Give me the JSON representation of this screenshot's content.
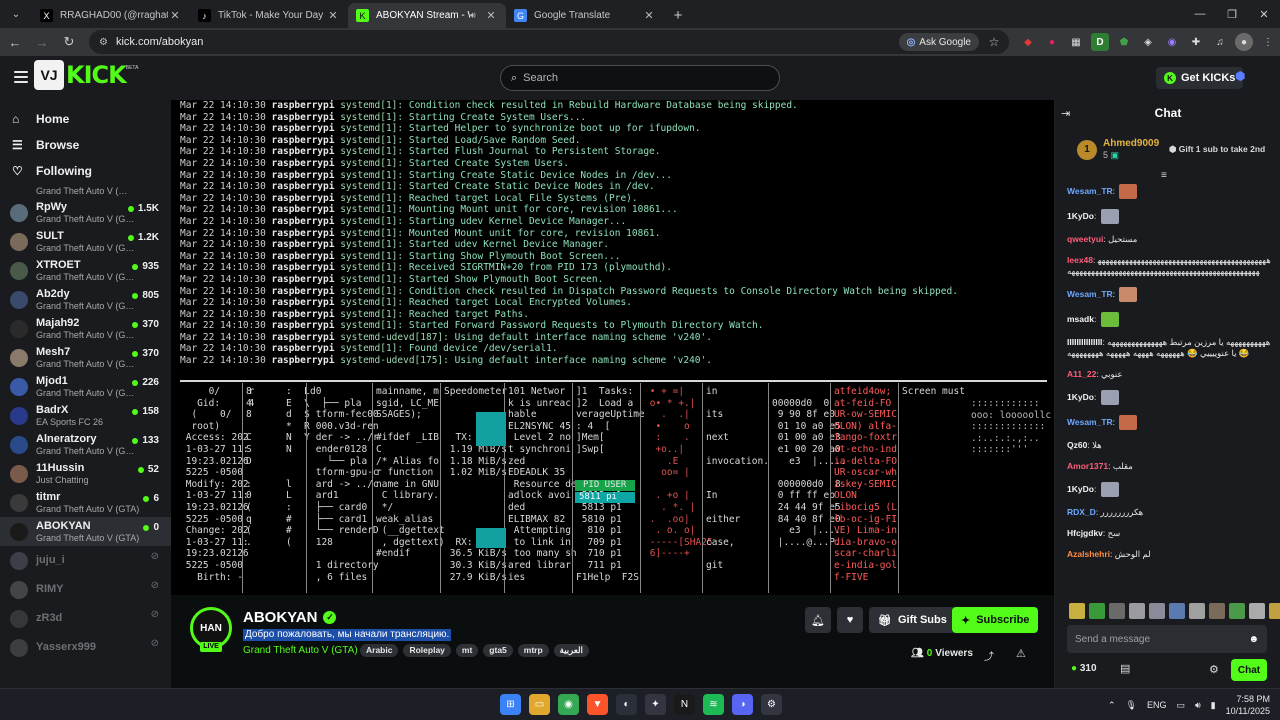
{
  "browser": {
    "tabs": [
      {
        "title": "RRAGHAD00 (@rragha006) / X",
        "fav": "X",
        "favBg": "#000000",
        "favFg": "#ffffff",
        "active": false
      },
      {
        "title": "TikTok - Make Your Day",
        "fav": "♪",
        "favBg": "#000000",
        "favFg": "#ffffff",
        "active": false
      },
      {
        "title": "ABOKYAN Stream - Watch Li",
        "fav": "K",
        "favBg": "#53fc18",
        "favFg": "#000000",
        "active": true
      },
      {
        "title": "Google Translate",
        "fav": "G",
        "favBg": "#4285f4",
        "favFg": "#ffffff",
        "active": false
      }
    ],
    "url": "kick.com/abokyan",
    "ask_google": "Ask Google"
  },
  "kick": {
    "logo_text": "KICK",
    "logo_beta": "BETA",
    "search_placeholder": "Search",
    "get_kicks": "Get KICKs"
  },
  "sidebar": {
    "nav": [
      {
        "label": "Home",
        "icon": "⌂"
      },
      {
        "label": "Browse",
        "icon": "☰"
      },
      {
        "label": "Following",
        "icon": "♡"
      }
    ],
    "partial_game": "Grand Theft Auto V (…",
    "channels": [
      {
        "name": "RpWy",
        "game": "Grand Theft Auto V (G…",
        "viewers": "1.5K",
        "live": true,
        "color": "#5a6b7a"
      },
      {
        "name": "SULT",
        "game": "Grand Theft Auto V (G…",
        "viewers": "1.2K",
        "live": true,
        "color": "#7a6a5a"
      },
      {
        "name": "XTROET",
        "game": "Grand Theft Auto V (G…",
        "viewers": "935",
        "live": true,
        "color": "#4a5a4a"
      },
      {
        "name": "Ab2dy",
        "game": "Grand Theft Auto V (G…",
        "viewers": "805",
        "live": true,
        "color": "#3a4a6a"
      },
      {
        "name": "Majah92",
        "game": "Grand Theft Auto V (G…",
        "viewers": "370",
        "live": true,
        "color": "#2a2a2a"
      },
      {
        "name": "Mesh7",
        "game": "Grand Theft Auto V (G…",
        "viewers": "370",
        "live": true,
        "color": "#8a7a6a"
      },
      {
        "name": "Mjod1",
        "game": "Grand Theft Auto V (G…",
        "viewers": "226",
        "live": true,
        "color": "#3a5aa8"
      },
      {
        "name": "BadrX",
        "game": "EA Sports FC 26",
        "viewers": "158",
        "live": true,
        "color": "#2a3a8a"
      },
      {
        "name": "Alneratzory",
        "game": "Grand Theft Auto V (G…",
        "viewers": "133",
        "live": true,
        "color": "#2a4a8a"
      },
      {
        "name": "11Hussin",
        "game": "Just Chatting",
        "viewers": "52",
        "live": true,
        "color": "#7a5a4a"
      },
      {
        "name": "titmr",
        "game": "Grand Theft Auto V (GTA)",
        "viewers": "6",
        "live": true,
        "color": "#3a3a3a"
      },
      {
        "name": "ABOKYAN",
        "game": "Grand Theft Auto V (GTA)",
        "viewers": "0",
        "live": true,
        "color": "#1a1a1a",
        "active": true
      },
      {
        "name": "juju_i",
        "game": "",
        "viewers": "",
        "live": false,
        "color": "#6a6a7a"
      },
      {
        "name": "RIMY",
        "game": "",
        "viewers": "",
        "live": false,
        "color": "#7a7a7a"
      },
      {
        "name": "zR3d",
        "game": "",
        "viewers": "",
        "live": false,
        "color": "#5a5a5a"
      },
      {
        "name": "Yasserx999",
        "game": "",
        "viewers": "",
        "live": false,
        "color": "#6a6a6a"
      }
    ]
  },
  "video": {
    "boot_log": [
      [
        "Mar 22 14:10:30",
        "raspberrypi",
        "systemd[1]:",
        "Condition check resulted in Rebuild Hardware Database being skipped."
      ],
      [
        "Mar 22 14:10:30",
        "raspberrypi",
        "systemd[1]:",
        "Starting Create System Users..."
      ],
      [
        "Mar 22 14:10:30",
        "raspberrypi",
        "systemd[1]:",
        "Started Helper to synchronize boot up for ifupdown."
      ],
      [
        "Mar 22 14:10:30",
        "raspberrypi",
        "systemd[1]:",
        "Started Load/Save Random Seed."
      ],
      [
        "Mar 22 14:10:30",
        "raspberrypi",
        "systemd[1]:",
        "Started Flush Journal to Persistent Storage."
      ],
      [
        "Mar 22 14:10:30",
        "raspberrypi",
        "systemd[1]:",
        "Started Create System Users."
      ],
      [
        "Mar 22 14:10:30",
        "raspberrypi",
        "systemd[1]:",
        "Starting Create Static Device Nodes in /dev..."
      ],
      [
        "Mar 22 14:10:30",
        "raspberrypi",
        "systemd[1]:",
        "Started Create Static Device Nodes in /dev."
      ],
      [
        "Mar 22 14:10:30",
        "raspberrypi",
        "systemd[1]:",
        "Reached target Local File Systems (Pre)."
      ],
      [
        "Mar 22 14:10:30",
        "raspberrypi",
        "systemd[1]:",
        "Mounting Mount unit for core, revision 10861..."
      ],
      [
        "Mar 22 14:10:30",
        "raspberrypi",
        "systemd[1]:",
        "Starting udev Kernel Device Manager..."
      ],
      [
        "Mar 22 14:10:30",
        "raspberrypi",
        "systemd[1]:",
        "Mounted Mount unit for core, revision 10861."
      ],
      [
        "Mar 22 14:10:30",
        "raspberrypi",
        "systemd[1]:",
        "Started udev Kernel Device Manager."
      ],
      [
        "Mar 22 14:10:30",
        "raspberrypi",
        "systemd[1]:",
        "Starting Show Plymouth Boot Screen..."
      ],
      [
        "Mar 22 14:10:30",
        "raspberrypi",
        "systemd[1]:",
        "Received SIGRTMIN+20 from PID 173 (plymouthd)."
      ],
      [
        "Mar 22 14:10:30",
        "raspberrypi",
        "systemd[1]:",
        "Started Show Plymouth Boot Screen."
      ],
      [
        "Mar 22 14:10:30",
        "raspberrypi",
        "systemd[1]:",
        "Condition check resulted in Dispatch Password Requests to Console Directory Watch being skipped."
      ],
      [
        "Mar 22 14:10:30",
        "raspberrypi",
        "systemd[1]:",
        "Reached target Local Encrypted Volumes."
      ],
      [
        "Mar 22 14:10:30",
        "raspberrypi",
        "systemd[1]:",
        "Reached target Paths."
      ],
      [
        "Mar 22 14:10:30",
        "raspberrypi",
        "systemd[1]:",
        "Started Forward Password Requests to Plymouth Directory Watch."
      ],
      [
        "Mar 22 14:10:30",
        "raspberrypi",
        "systemd-udevd[187]:",
        "Using default interface naming scheme 'v240'."
      ],
      [
        "Mar 22 14:10:30",
        "raspberrypi",
        "systemd[1]:",
        "Found device /dev/serial1."
      ],
      [
        "Mar 22 14:10:30",
        "raspberrypi",
        "systemd-udevd[175]:",
        "Using default interface naming scheme 'v240'."
      ]
    ],
    "panels": [
      "     0/     r\n   Gid:     4\n  (    0/    \n  root)       \n Access: 202\n 1-03-27 11:\n 19:23.02126\n 5225 -0500\n Modify: 202\n 1-03-27 11:\n 19:23.02126\n 5225 -0500\n Change: 202\n 1-03-27 11:\n 19:23.02126\n 5225 -0500\n   Birth: -",
      "8\n4\n8\n\nC\nS\nD\n\n:\n0\n(\nq\n(\n.\n",
      ":\nE\nd\n*\nN\nN\n\n\nl\nL\n:\n#\n#\n(\n\n",
      "L\n\\\n$\nR\nY\n\n\n\n\n\n\n\n\n\n\n\n",
      "d0\n  ├── pla\n tform-fec00\n 000.v3d-ren\n der -> ../r\n ender0128\n   └── pla\n tform-gpu-c\n ard -> ../c\n ard1\n ├── card0\n ├── card1\n └── renderD\n 128\n\n 1 directory\n , 6 files",
      "mainname, m\nsgid, LC_ME\nSSAGES);\n\n#ifdef _LIB\nC\n/* Alias fo\nr function \nname in GNU\n C library.\n */\nweak_alias\n (__dgettext\n , dgettext)\n#endif",
      "Speedometer\n\n\n\n  TX: eth0\n 1.19 MiB/s\n 1.18 MiB/s\n 1.02 MiB/s\n\n\n\n\n\n  RX: eth0\n 36.5 KiB/s\n 30.3 KiB/s\n 27.9 KiB/s",
      "101 Networ\nk is unreac\nhable\nEL2NSYNC 45\n Level 2 no\nt synchroni\nzed\nEDEADLK 35\n Resource de\nadlock avoi\nded\nELIBMAX 82\n Attempting\n to link in\n too many sh\nared librar\nies",
      "]1  Tasks:\n]2  Load a\nverageUptime\n: 4  [\n]Mem[\n]Swp[\n\n\n\n 5812 p1\n 5813 p1\n 5810 p1\n  810 p1\n  709 p1\n  710 p1\n  711 p1\nF1Help  F2S",
      " • + =|\n o• * +.|\n   .  .|\n  •    o\n  :    .\n  +o..|\n    .E\n   oo= |\n\n  . +o |\n   . *. |\n .  .oo|\n  . o. o|\n -----[SHA25\n 6]----+",
      "in\n\nits\n\nnext\n\ninvocation.\n\n\nIn\n\neither\n\ncase,\n\ngit",
      "\n00000d0  0\n 9 90 8f e0\n 01 10 a0 e5\n 01 00 a0 e3\n e1 00 20 a0\n   e3  |.....\n\n 000000d0  8\n 0 ff ff eb\n 24 44 9f e5\n 84 40 8f e0\n   e3  |....\n |....@...P.",
      "atfeid4ow;\nat-feid-FO\nUR-ow-SEMIC\nOLON) alfa-\ntango-foxtr\not-echo-ind\nia-delta-FO\nUR-oscar-wh\niskey-SEMIC\nOLON\nLibocig5 (L\nlb-oc-ig-FI\nVE) Lima-in\ndia-bravo-o\nscar-charli\ne-india-gol\nf-FIVE",
      "Screen must"
    ],
    "panel_right_dots": "::::::::::::\nooo: looooollc\n:::::::::::::\n.:..:.:.,:..\n:::::::'''",
    "pid_label": "PID USER",
    "pid_selected": "5811 pi"
  },
  "stream": {
    "avatar_text": "HAN",
    "live_label": "LIVE",
    "name": "ABOKYAN",
    "title": "Добро пожаловать, мы начали трансляцию.",
    "category": "Grand Theft Auto V (GTA)",
    "tags": [
      "Arabic",
      "Roleplay",
      "mt",
      "gta5",
      "mtrp",
      "العربية"
    ],
    "gift_subs": "Gift Subs",
    "subscribe": "Subscribe",
    "viewers_count": "0",
    "viewers_label": "Viewers"
  },
  "chat": {
    "title": "Chat",
    "pinned_user": "Ahmed9009",
    "pinned_rank": "1",
    "pinned_count": "5",
    "gift_note": "Gift 1 sub to take 2nd",
    "messages": [
      {
        "user": "Wesam_TR",
        "color": "#6ea8ff",
        "text": "",
        "emote": "#c46a4a"
      },
      {
        "user": "1KyDo",
        "color": "#f3f3f3",
        "text": "",
        "emote": "#9aa0b0"
      },
      {
        "user": "qweetyui",
        "color": "#ff5c7a",
        "text": "مستحيل"
      },
      {
        "user": "leex48",
        "color": "#ff5c7a",
        "text": "ههههههههههههههههههههههههههههههههههههههههههههههههههههههههههههههههههههههههههههههههههههههههههههه"
      },
      {
        "user": "Wesam_TR",
        "color": "#6ea8ff",
        "text": "",
        "emote": "#c88a6a"
      },
      {
        "user": "msadk",
        "color": "#f3f3f3",
        "text": "",
        "emote": "#6bbd3a"
      },
      {
        "user": "IIIIIIIIIIIIIII",
        "color": "#f3f3f3",
        "text": "ههههههههههه يا مرزين مرتبط ههههههههههههههه يا عنوييييي 😂 ههههههه ههههه هههههه ههههههههه 😂"
      },
      {
        "user": "A11_22",
        "color": "#ff5c7a",
        "text": "عنوبي"
      },
      {
        "user": "1KyDo",
        "color": "#f3f3f3",
        "text": "",
        "emote": "#9aa0b0"
      },
      {
        "user": "Wesam_TR",
        "color": "#6ea8ff",
        "text": "",
        "emote": "#c46a4a"
      },
      {
        "user": "Qz60",
        "color": "#f3f3f3",
        "text": "هلا"
      },
      {
        "user": "Amor1371",
        "color": "#ff5c7a",
        "text": "مقلب"
      },
      {
        "user": "1KyDo",
        "color": "#f3f3f3",
        "text": "",
        "emote": "#9aa0b0"
      },
      {
        "user": "RDX_D",
        "color": "#6ea8ff",
        "text": "هكرررررررر"
      },
      {
        "user": "Hfcjgdkv",
        "color": "#f3f3f3",
        "text": "سح"
      },
      {
        "user": "Azalshehri",
        "color": "#ff8c42",
        "text": "لم الوحش"
      }
    ],
    "emotes": [
      "#c8b040",
      "#3a9a3a",
      "#6a6a6a",
      "#9a9aa0",
      "#8a8a9a",
      "#5a7ab0",
      "#a0a0a0",
      "#7a6a5a",
      "#4a9a4a",
      "#aaaaaa",
      "#c0a040",
      "#53fc18"
    ],
    "input_placeholder": "Send a message",
    "kicks": "310",
    "chat_button": "Chat"
  },
  "taskbar": {
    "apps": [
      {
        "name": "windows-start-icon",
        "bg": "#3b82f6",
        "glyph": "⊞"
      },
      {
        "name": "file-explorer-icon",
        "bg": "#e0a82e",
        "glyph": "▭"
      },
      {
        "name": "chrome-icon",
        "bg": "#34a853",
        "glyph": "◉"
      },
      {
        "name": "brave-icon",
        "bg": "#fb542b",
        "glyph": "▼"
      },
      {
        "name": "steam-icon",
        "bg": "#2a2f3a",
        "glyph": "◐"
      },
      {
        "name": "app-icon",
        "bg": "#333640",
        "glyph": "✦"
      },
      {
        "name": "netflix-icon",
        "bg": "#1a1a1a",
        "glyph": "N"
      },
      {
        "name": "spotify-icon",
        "bg": "#1db954",
        "glyph": "≋"
      },
      {
        "name": "discord-icon",
        "bg": "#5865f2",
        "glyph": "◑"
      },
      {
        "name": "settings-icon",
        "bg": "#333640",
        "glyph": "⚙"
      }
    ],
    "lang": "ENG",
    "time": "7:58 PM",
    "date": "10/11/2025"
  }
}
